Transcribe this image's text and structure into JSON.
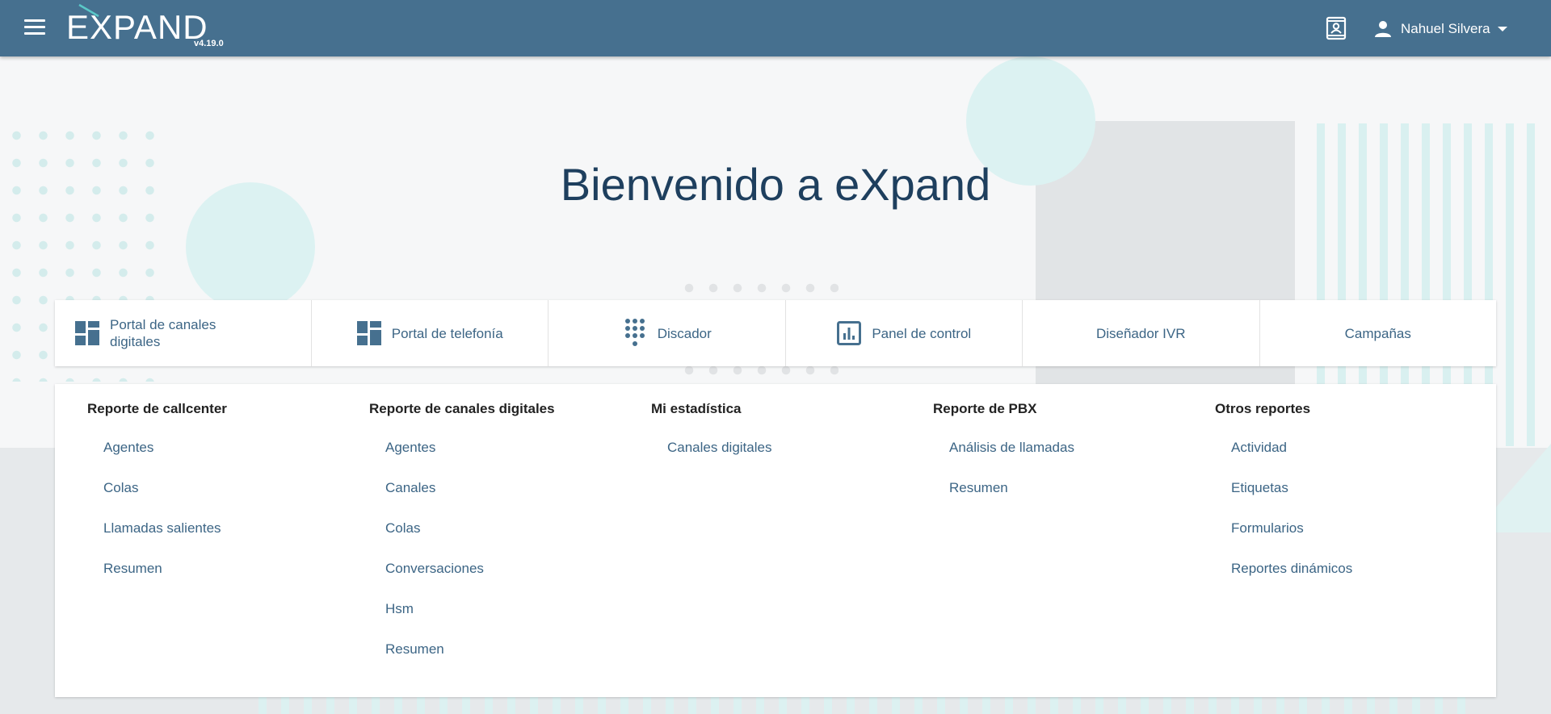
{
  "header": {
    "menu_icon": "hamburger-menu-icon",
    "logo_text": "EXPAND",
    "version": "v4.19.0",
    "contact_icon": "contact-card-icon",
    "user_icon": "person-icon",
    "user_name": "Nahuel Silvera"
  },
  "welcome_title": "Bienvenido a eXpand",
  "portals": [
    {
      "label": "Portal de canales digitales",
      "icon": "dashboard-icon"
    },
    {
      "label": "Portal de telefonía",
      "icon": "dashboard-icon"
    },
    {
      "label": "Discador",
      "icon": "dialpad-icon"
    },
    {
      "label": "Panel de control",
      "icon": "analytics-icon"
    },
    {
      "label": "Diseñador IVR",
      "icon": ""
    },
    {
      "label": "Campañas",
      "icon": ""
    }
  ],
  "reports": {
    "callcenter": {
      "title": "Reporte de callcenter",
      "items": [
        "Agentes",
        "Colas",
        "Llamadas salientes",
        "Resumen"
      ]
    },
    "digital": {
      "title": "Reporte de canales digitales",
      "items": [
        "Agentes",
        "Canales",
        "Colas",
        "Conversaciones",
        "Hsm",
        "Resumen"
      ]
    },
    "mine": {
      "title": "Mi estadística",
      "items": [
        "Canales digitales"
      ]
    },
    "pbx": {
      "title": "Reporte de PBX",
      "items": [
        "Análisis de llamadas",
        "Resumen"
      ]
    },
    "other": {
      "title": "Otros reportes",
      "items": [
        "Actividad",
        "Etiquetas",
        "Formularios",
        "Reportes dinámicos"
      ]
    }
  },
  "colors": {
    "header_bg": "#46708f",
    "title": "#1e3f5e",
    "link": "#3c6585",
    "accent_teal": "#dcf2f2"
  }
}
